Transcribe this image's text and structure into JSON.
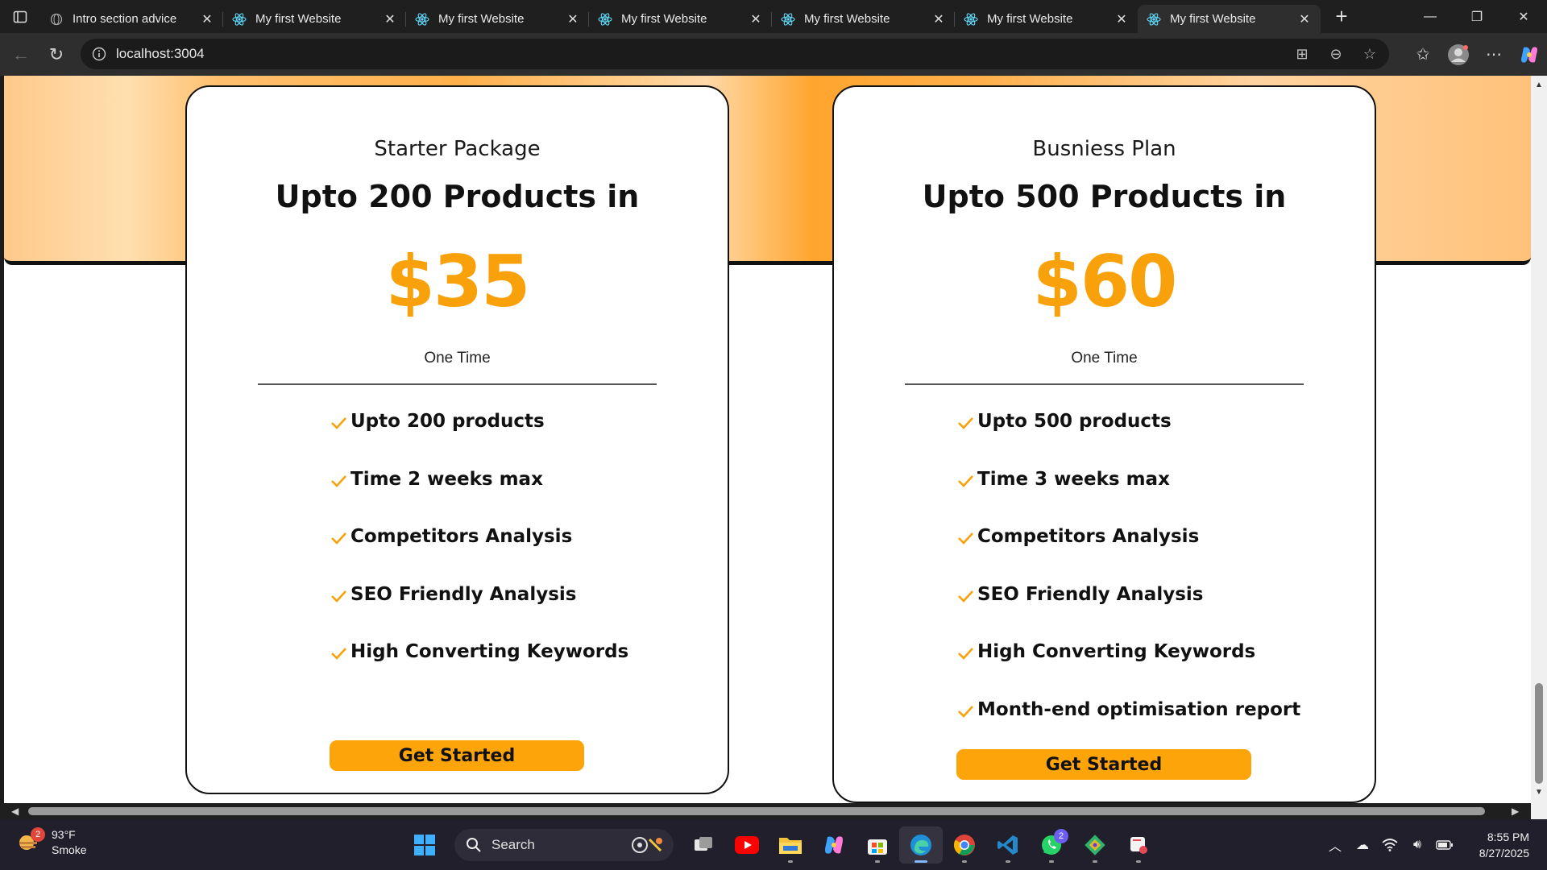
{
  "browser": {
    "tabs": [
      {
        "title": "Intro section advice",
        "icon": "globe-icon",
        "active": false
      },
      {
        "title": "My first Website",
        "icon": "react-icon",
        "active": false
      },
      {
        "title": "My first Website",
        "icon": "react-icon",
        "active": false
      },
      {
        "title": "My first Website",
        "icon": "react-icon",
        "active": false
      },
      {
        "title": "My first Website",
        "icon": "react-icon",
        "active": false
      },
      {
        "title": "My first Website",
        "icon": "react-icon",
        "active": false
      },
      {
        "title": "My first Website",
        "icon": "react-icon",
        "active": true
      }
    ],
    "url": "localhost:3004"
  },
  "page": {
    "cards": [
      {
        "package": "Starter Package",
        "headline": "Upto 200 Products in",
        "price": "$35",
        "billing": "One Time",
        "features": [
          "Upto 200 products",
          "Time 2 weeks max",
          "Competitors Analysis",
          "SEO Friendly Analysis",
          "High Converting Keywords"
        ],
        "cta": "Get Started"
      },
      {
        "package": "Busniess Plan",
        "headline": "Upto 500 Products in",
        "price": "$60",
        "billing": "One Time",
        "features": [
          "Upto 500 products",
          "Time 3 weeks max",
          "Competitors Analysis",
          "SEO Friendly Analysis",
          "High Converting Keywords",
          "Month-end optimisation report"
        ],
        "cta": "Get Started"
      }
    ],
    "colors": {
      "accent": "#f9a10a",
      "button": "#fca40a",
      "band": "#ffb04a"
    }
  },
  "taskbar": {
    "weather": {
      "temp": "93°F",
      "condition": "Smoke",
      "badge": "2"
    },
    "search_label": "Search",
    "apps": [
      "task-view-icon",
      "youtube-icon",
      "file-explorer-icon",
      "copilot-icon",
      "store-icon",
      "edge-icon",
      "chrome-icon",
      "vscode-icon",
      "whatsapp-icon",
      "git-icon",
      "snipping-tool-icon"
    ],
    "whatsapp_badge": "2",
    "time": "8:55 PM",
    "date": "8/27/2025"
  }
}
